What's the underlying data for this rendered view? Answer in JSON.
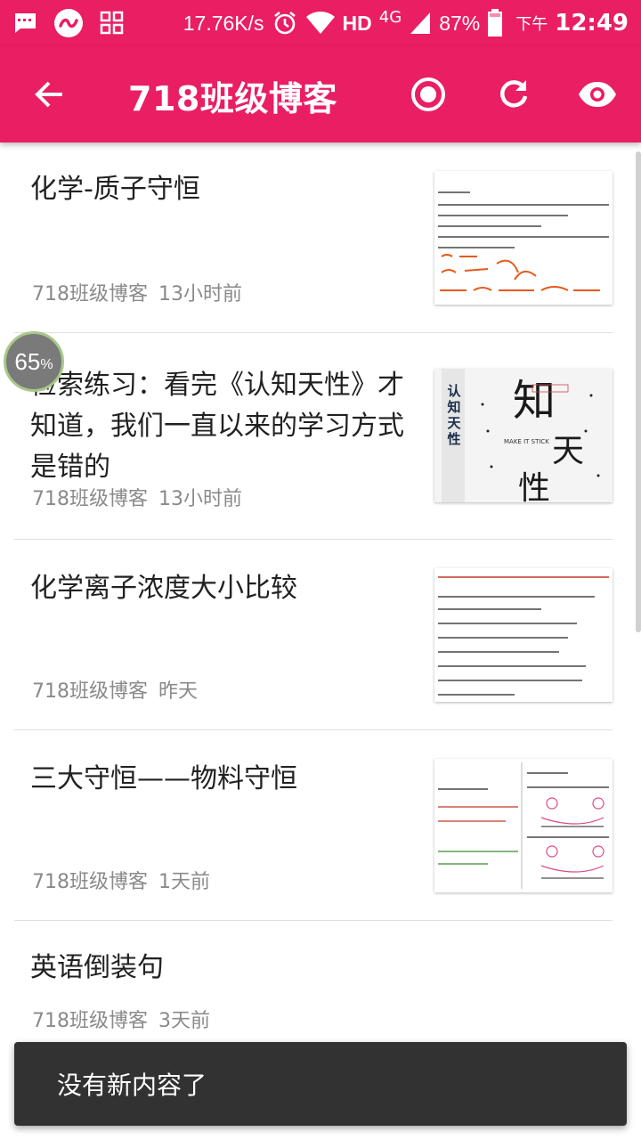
{
  "status_bar": {
    "speed": "17.76K/s",
    "network": "HD",
    "signal_type": "4G",
    "battery": "87%",
    "time_prefix": "下午",
    "time": "12:49",
    "icons": [
      "message-icon",
      "app-icon",
      "grid-icon",
      "alarm-icon",
      "wifi-icon",
      "signal-icon",
      "battery-icon"
    ]
  },
  "app_bar": {
    "title": "718班级博客",
    "actions": [
      "back-icon",
      "record-icon",
      "refresh-icon",
      "eye-icon"
    ]
  },
  "articles": [
    {
      "title": "化学-质子守恒",
      "author": "718班级博客",
      "time": "13小时前"
    },
    {
      "title": "检索练习：看完《认知天性》才知道，我们一直以来的学习方式是错的",
      "author": "718班级博客",
      "time": "13小时前"
    },
    {
      "title": "化学离子浓度大小比较",
      "author": "718班级博客",
      "time": "昨天"
    },
    {
      "title": "三大守恒——物料守恒",
      "author": "718班级博客",
      "time": "1天前"
    },
    {
      "title": "英语倒装句",
      "author": "718班级博客",
      "time": "3天前"
    }
  ],
  "thumbnails": {
    "book_title_vertical": "认知天性",
    "book_title_large": [
      "知",
      "天",
      "性"
    ],
    "book_subtitle": "MAKE IT STICK"
  },
  "progress_bubble": {
    "value": "65",
    "unit": "%"
  },
  "snackbar": {
    "message": "没有新内容了"
  },
  "colors": {
    "primary": "#e91e63",
    "snackbar": "#323232",
    "meta_text": "#8a8a8a"
  }
}
